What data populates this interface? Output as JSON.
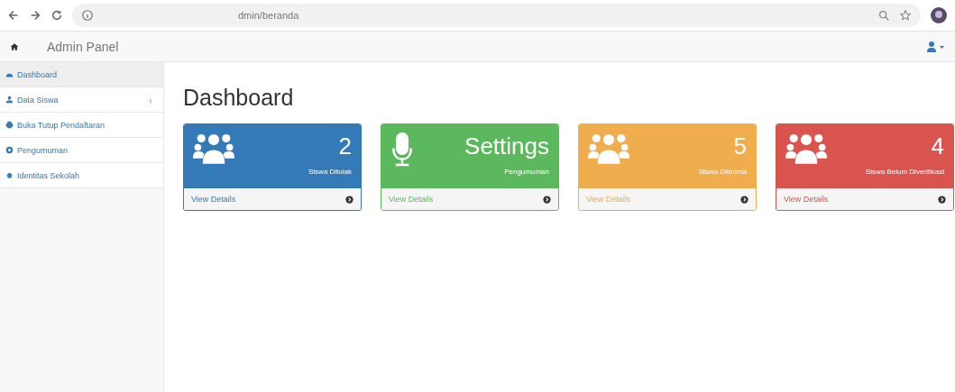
{
  "browser": {
    "url": "dmin/beranda"
  },
  "navbar": {
    "brand": "Admin Panel"
  },
  "sidebar": {
    "items": [
      {
        "label": "Dashboard",
        "selected": true
      },
      {
        "label": "Data Siswa",
        "selected": false,
        "chevron": "‹"
      },
      {
        "label": "Buka Tutup Pendaftaran",
        "selected": false
      },
      {
        "label": "Pengumuman",
        "selected": false
      },
      {
        "label": "Identitas Sekolah",
        "selected": false
      }
    ]
  },
  "page": {
    "title": "Dashboard"
  },
  "panels": [
    {
      "kind": "people",
      "color": "#337ab7",
      "value": "2",
      "caption": "Siswa Ditolak",
      "link": "View Details"
    },
    {
      "kind": "mic",
      "color": "#5cb85c",
      "value": "Settings",
      "caption": "Pengumuman",
      "link": "View Details"
    },
    {
      "kind": "people",
      "color": "#f0ad4e",
      "value": "5",
      "caption": "Siswa Diterima",
      "link": "View Details"
    },
    {
      "kind": "people",
      "color": "#d9534f",
      "value": "4",
      "caption": "Siswa Belum Diverifikasi",
      "link": "View Details"
    }
  ]
}
